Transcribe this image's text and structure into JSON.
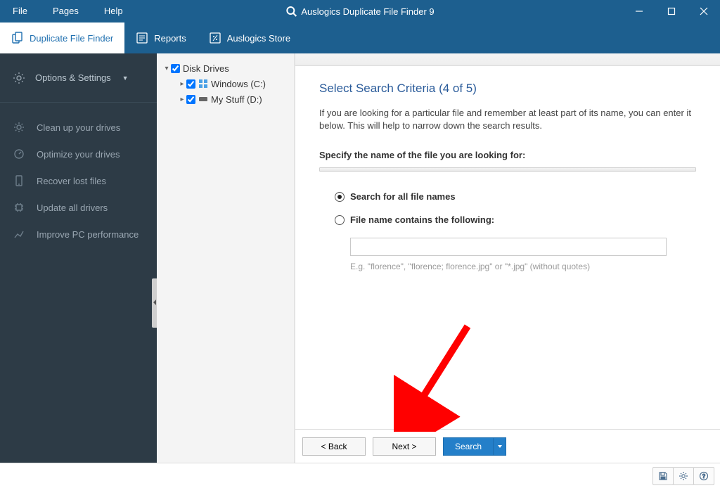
{
  "window": {
    "title": "Auslogics Duplicate File Finder 9",
    "menus": {
      "file": "File",
      "pages": "Pages",
      "help": "Help"
    }
  },
  "toolbar": {
    "finder": "Duplicate File Finder",
    "reports": "Reports",
    "store": "Auslogics Store"
  },
  "sidebar": {
    "options_label": "Options & Settings",
    "items": {
      "cleanup": "Clean up your drives",
      "optimize": "Optimize your drives",
      "recover": "Recover lost files",
      "drivers": "Update all drivers",
      "improve": "Improve PC performance"
    }
  },
  "tree": {
    "root": "Disk Drives",
    "c_label": "Windows (C:)",
    "d_label": "My Stuff (D:)"
  },
  "content": {
    "heading": "Select Search Criteria (4 of 5)",
    "intro": "If you are looking for a particular file and remember at least part of its name, you can enter it below. This will help to narrow down the search results.",
    "section_label": "Specify the name of the file you are looking for:",
    "radio_all": "Search for all file names",
    "radio_contains": "File name contains the following:",
    "input_value": "",
    "hint": "E.g. \"florence\", \"florence; florence.jpg\" or \"*.jpg\" (without quotes)"
  },
  "buttons": {
    "back": "< Back",
    "next": "Next >",
    "search": "Search"
  }
}
